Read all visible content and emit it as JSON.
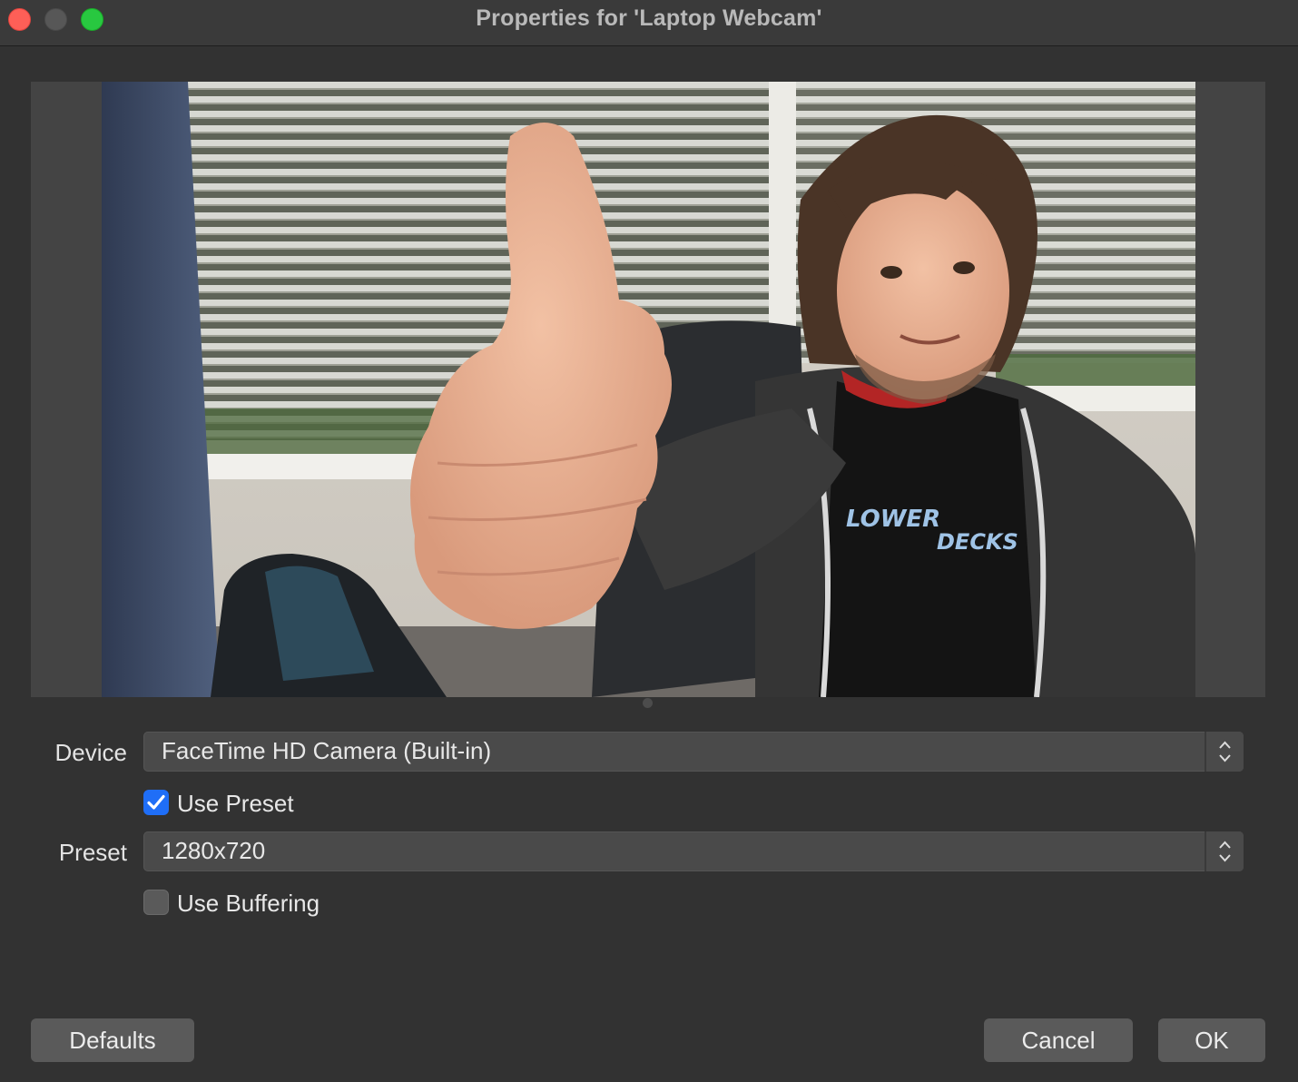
{
  "window": {
    "title": "Properties for 'Laptop Webcam'"
  },
  "icons": {
    "close": "close-traffic-light",
    "minimize": "minimize-traffic-light",
    "maximize": "maximize-traffic-light",
    "select_arrows": "up-down-chevron-icon",
    "check": "checkmark-icon"
  },
  "form": {
    "device": {
      "label": "Device",
      "value": "FaceTime HD Camera (Built-in)"
    },
    "use_preset": {
      "label": "Use Preset",
      "checked": true
    },
    "preset": {
      "label": "Preset",
      "value": "1280x720"
    },
    "use_buffering": {
      "label": "Use Buffering",
      "checked": false
    }
  },
  "buttons": {
    "defaults": "Defaults",
    "cancel": "Cancel",
    "ok": "OK"
  },
  "colors": {
    "accent": "#1f6ef7",
    "close": "#fe5f57",
    "maximize": "#28c840"
  }
}
